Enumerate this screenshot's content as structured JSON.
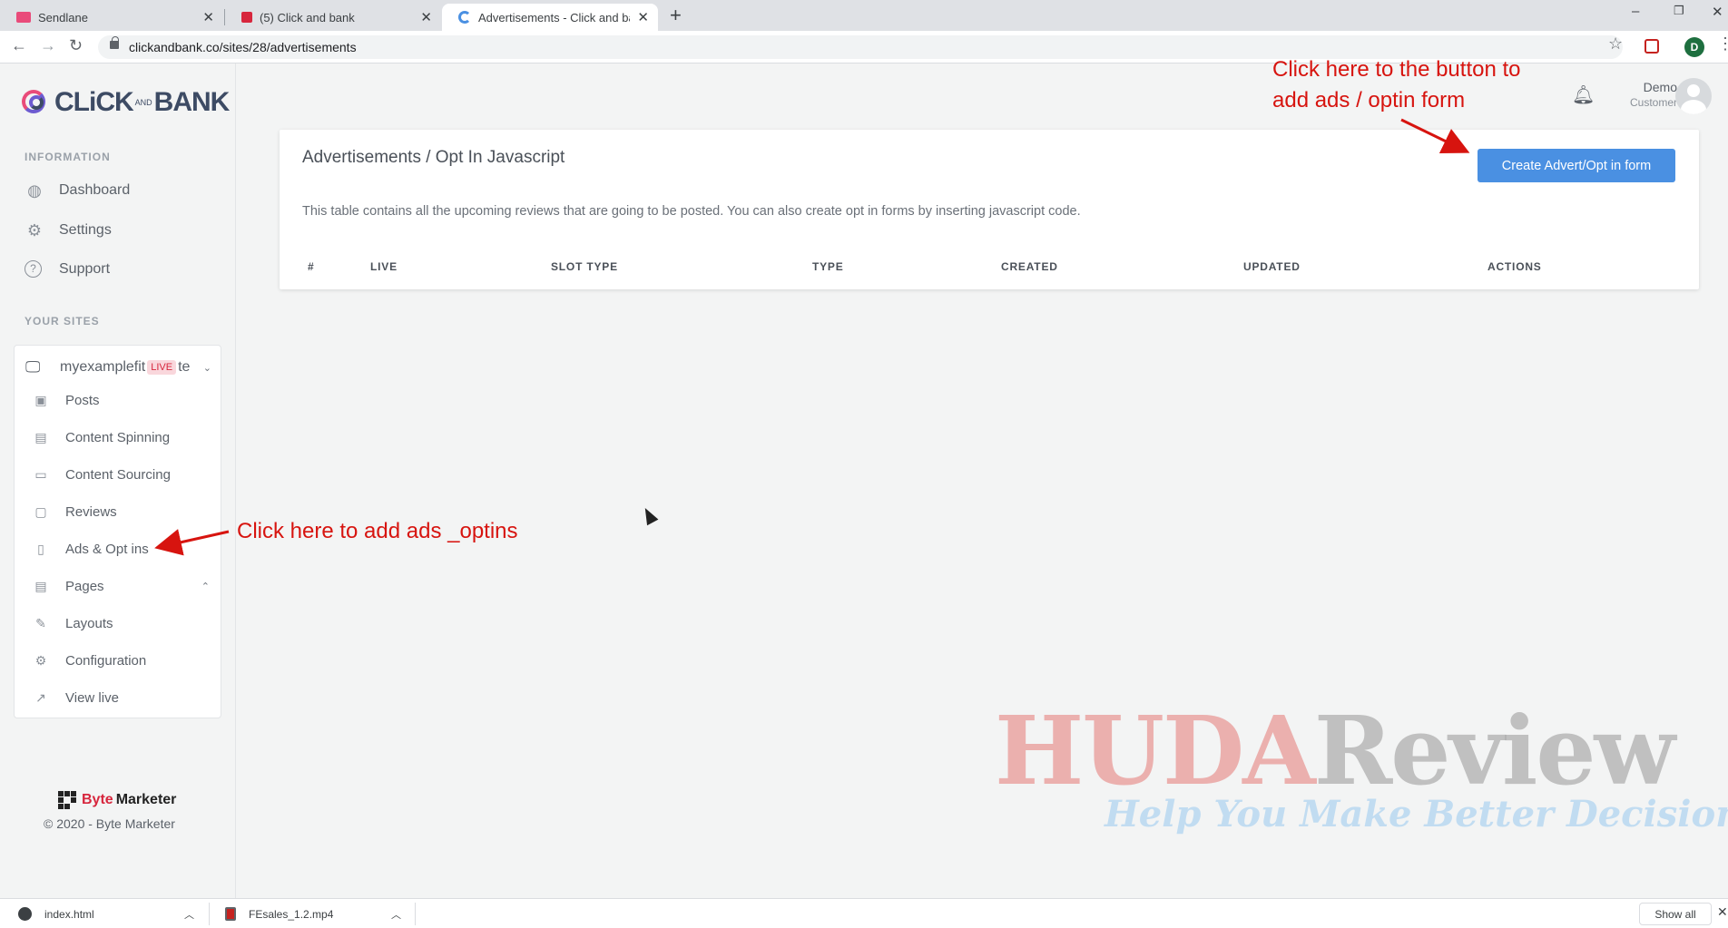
{
  "browser": {
    "tabs": [
      {
        "title": "Sendlane",
        "favicon_color": "#e94b7a"
      },
      {
        "title": "(5) Click and bank",
        "favicon_color": "#d7263d"
      },
      {
        "title": "Advertisements - Click and bank",
        "favicon_color": "#4a90e2"
      }
    ],
    "new_tab": "+",
    "url": "clickandbank.co/sites/28/advertisements",
    "profile_initial": "D"
  },
  "logo": {
    "left": "CLiCK",
    "mid": "AND",
    "right": "BANK"
  },
  "sidebar": {
    "information_head": "INFORMATION",
    "info_items": [
      {
        "label": "Dashboard",
        "icon": "globe-icon"
      },
      {
        "label": "Settings",
        "icon": "gear-icon"
      },
      {
        "label": "Support",
        "icon": "help-icon"
      }
    ],
    "your_sites_head": "YOUR SITES",
    "site": {
      "name_start": "myexamplefit",
      "badge": "LIVE",
      "name_end": "te"
    },
    "site_items": [
      {
        "label": "Posts",
        "icon": "posts-icon"
      },
      {
        "label": "Content Spinning",
        "icon": "document-icon"
      },
      {
        "label": "Content Sourcing",
        "icon": "archive-icon"
      },
      {
        "label": "Reviews",
        "icon": "comment-icon"
      },
      {
        "label": "Ads & Opt ins",
        "icon": "tablet-icon"
      },
      {
        "label": "Pages",
        "icon": "pages-icon"
      },
      {
        "label": "Layouts",
        "icon": "pen-icon"
      },
      {
        "label": "Configuration",
        "icon": "cog-icon"
      },
      {
        "label": "View live",
        "icon": "external-link-icon"
      }
    ],
    "footer_brand_byte": "Byte",
    "footer_brand_marketer": "Marketer",
    "copyright": "© 2020 - Byte Marketer"
  },
  "user": {
    "name": "Demo",
    "role": "Customer"
  },
  "main": {
    "title": "Advertisements / Opt In Javascript",
    "create_button": "Create Advert/Opt in form",
    "description": "This table contains all the upcoming reviews that are going to be posted. You can also create opt in forms by inserting javascript code.",
    "columns": [
      "#",
      "LIVE",
      "SLOT TYPE",
      "TYPE",
      "CREATED",
      "UPDATED",
      "ACTIONS"
    ]
  },
  "annotations": {
    "top_line1": "Click here to the button to",
    "top_line2": "add ads / optin form",
    "side": "Click here to add ads _optins",
    "color": "#d7140f"
  },
  "watermark": {
    "huda": "HUDA",
    "review": "Review",
    "tagline": "Help You Make Better Decisions"
  },
  "downloads": {
    "files": [
      "index.html",
      "FEsales_1.2.mp4"
    ],
    "show_all": "Show all"
  }
}
